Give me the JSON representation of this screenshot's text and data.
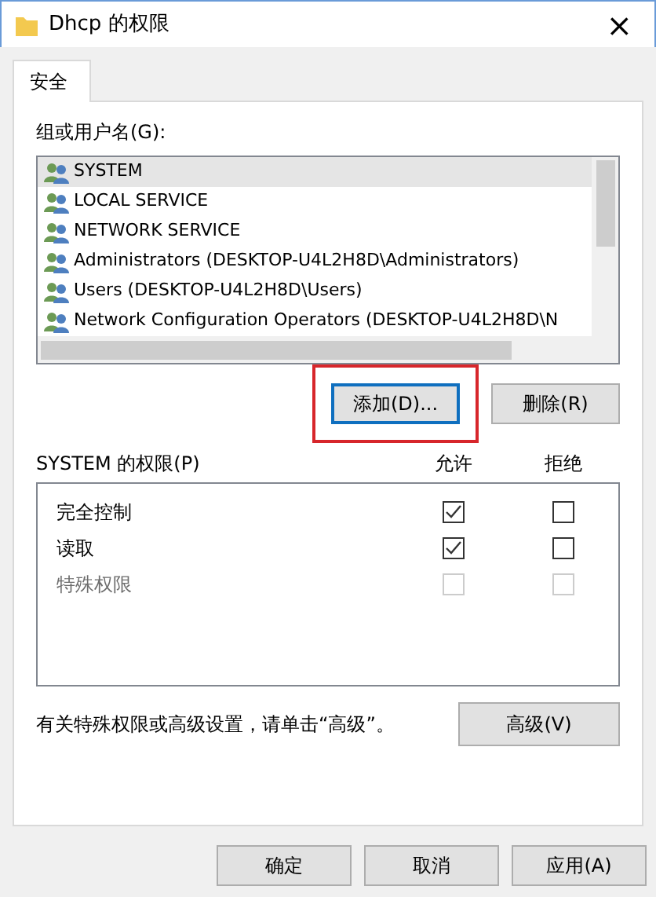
{
  "window": {
    "title": "Dhcp 的权限",
    "close": "×"
  },
  "tabs": [
    {
      "label": "安全",
      "selected": true
    }
  ],
  "users_label": "组或用户名(G):",
  "users": [
    {
      "name": "SYSTEM",
      "selected": true
    },
    {
      "name": "LOCAL SERVICE",
      "selected": false
    },
    {
      "name": "NETWORK SERVICE",
      "selected": false
    },
    {
      "name": "Administrators (DESKTOP-U4L2H8D\\Administrators)",
      "selected": false
    },
    {
      "name": "Users (DESKTOP-U4L2H8D\\Users)",
      "selected": false
    },
    {
      "name": "Network Configuration Operators (DESKTOP-U4L2H8D\\N",
      "selected": false
    }
  ],
  "user_buttons": [
    {
      "label": "添加(D)...",
      "highlighted": true
    },
    {
      "label": "删除(R)",
      "highlighted": false
    }
  ],
  "permissions": {
    "label": "SYSTEM 的权限(P)",
    "allow_header": "允许",
    "deny_header": "拒绝",
    "rows": [
      {
        "name": "完全控制",
        "allow": true,
        "deny": false,
        "disabled": false
      },
      {
        "name": "读取",
        "allow": true,
        "deny": false,
        "disabled": false
      },
      {
        "name": "特殊权限",
        "allow": false,
        "deny": false,
        "disabled": true
      }
    ]
  },
  "advanced_hint": "有关特殊权限或高级设置，请单击“高级”。",
  "advanced_button": "高级(V)",
  "dialog_buttons": [
    "确定",
    "取消",
    "应用(A)"
  ]
}
